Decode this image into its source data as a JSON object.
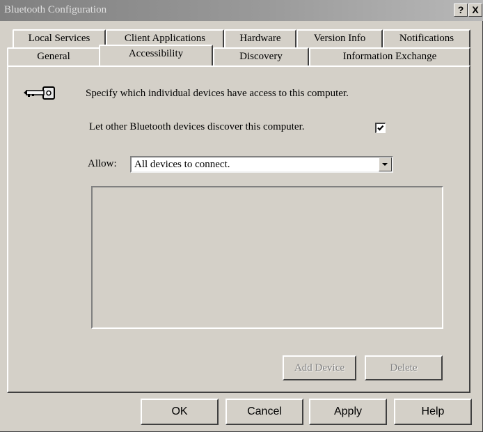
{
  "window": {
    "title": "Bluetooth Configuration",
    "help_button": "?",
    "close_button": "X"
  },
  "tabs": {
    "row1": [
      "Local Services",
      "Client Applications",
      "Hardware",
      "Version Info",
      "Notifications"
    ],
    "row2": [
      "General",
      "Accessibility",
      "Discovery",
      "Information Exchange"
    ],
    "active": "Accessibility"
  },
  "accessibility": {
    "icon": "key-icon",
    "description": "Specify which individual devices have access to this computer.",
    "discover_label": "Let other Bluetooth devices discover this computer.",
    "discover_checked": true,
    "allow_label": "Allow:",
    "allow_value": "All devices to connect.",
    "add_device_label": "Add Device",
    "delete_label": "Delete"
  },
  "footer": {
    "ok_label": "OK",
    "cancel_label": "Cancel",
    "apply_label": "Apply",
    "help_label": "Help"
  }
}
